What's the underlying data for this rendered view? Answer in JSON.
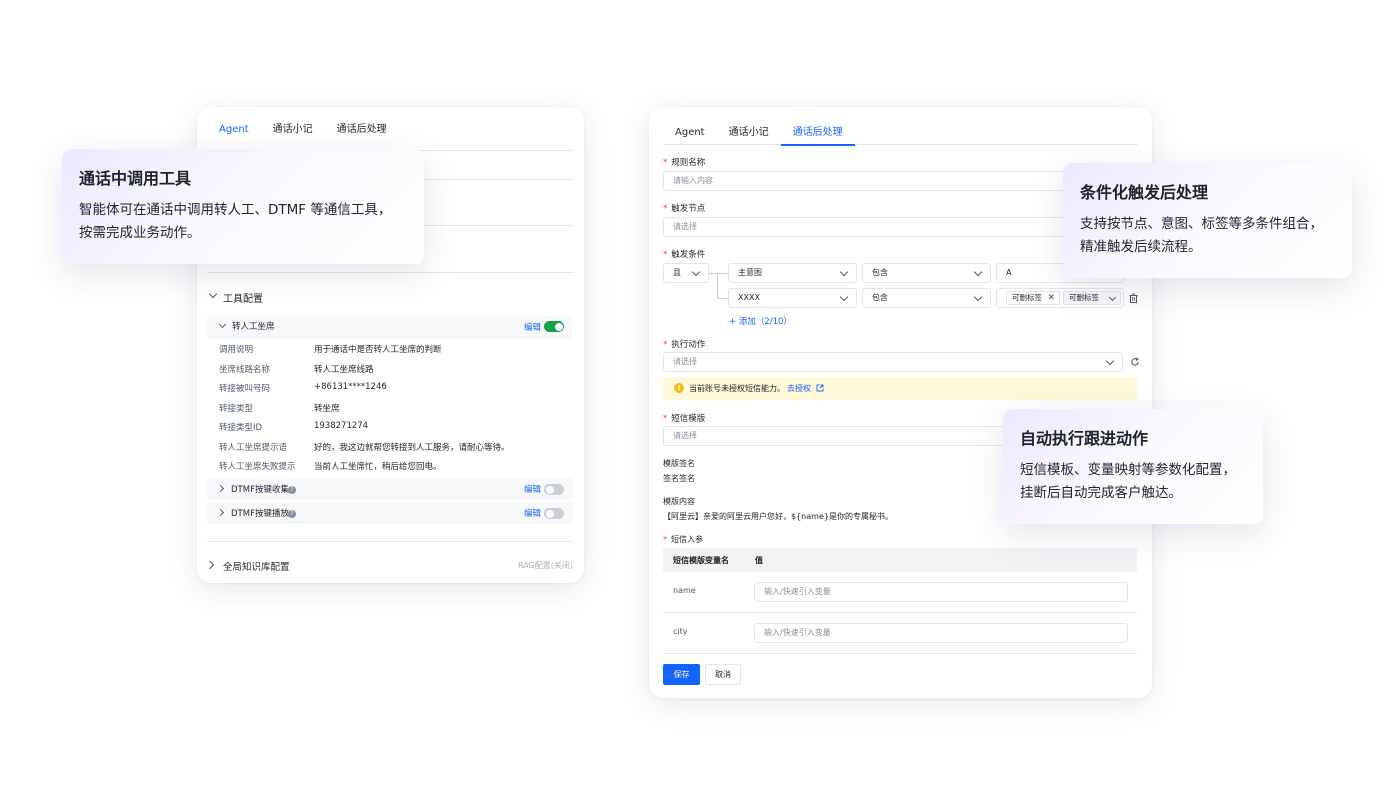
{
  "left_panel": {
    "tabs": [
      "Agent",
      "通话小记",
      "通话后处理"
    ],
    "tool_config_label": "工具配置",
    "transfer_title": "转人工坐席",
    "edit_label": "编辑",
    "transfer_rows": [
      {
        "k": "调用说明",
        "v": "用于通话中是否转人工坐席的判断"
      },
      {
        "k": "坐席线路名称",
        "v": "转人工坐席线路"
      },
      {
        "k": "转接被叫号码",
        "v": "+86131****1246"
      },
      {
        "k": "转接类型",
        "v": "转坐席"
      },
      {
        "k": "转接类型ID",
        "v": "1938271274"
      },
      {
        "k": "转人工坐席提示语",
        "v": "好的，我这边就帮您转接到人工服务，请耐心等待。"
      },
      {
        "k": "转人工坐席失败提示",
        "v": "当前人工坐席忙，稍后给您回电。"
      }
    ],
    "dtmf_collect": "DTMF按键收集",
    "dtmf_play": "DTMF按键播放",
    "help_glyph": "?",
    "knowledge_label": "全局知识库配置",
    "rag_label": "RAG配置(关闭)"
  },
  "right_panel": {
    "tabs": [
      "Agent",
      "通话小记",
      "通话后处理"
    ],
    "rule_name_label": "规则名称",
    "rule_name_placeholder": "请输入内容",
    "trigger_node_label": "触发节点",
    "trigger_node_placeholder": "请选择",
    "trigger_cond_label": "触发条件",
    "logic_op": "且",
    "cond1": {
      "field": "主意图",
      "op": "包含",
      "value": "A"
    },
    "cond2": {
      "field": "XXXX",
      "op": "包含",
      "tag1": "可删标签",
      "tag2": "可删标签"
    },
    "add_label": "+ 添加（2/10）",
    "action_label": "执行动作",
    "action_placeholder": "请选择",
    "warning_text": "当前账号未授权短信能力。",
    "warning_link": "去授权",
    "sms_template_label": "短信模版",
    "sms_template_placeholder": "请选择",
    "sign_label": "模版签名",
    "sign_value": "签名签名",
    "content_label": "模版内容",
    "content_value": "【阿里云】亲爱的阿里云用户您好，${name}是你的专属秘书。",
    "params_label": "短信入参",
    "params_table": {
      "headers": [
        "短信模版变量名",
        "值"
      ],
      "rows": [
        {
          "name": "name",
          "placeholder": "输入/快速引入变量"
        },
        {
          "name": "city",
          "placeholder": "输入/快速引入变量"
        }
      ]
    },
    "save_label": "保存",
    "cancel_label": "取消"
  },
  "cards": [
    {
      "title": "通话中调用工具",
      "line1": "智能体可在通话中调用转人工、DTMF 等通信工具，",
      "line2": "按需完成业务动作。"
    },
    {
      "title": "条件化触发后处理",
      "line1": "支持按节点、意图、标签等多条件组合，",
      "line2": "精准触发后续流程。"
    },
    {
      "title": "自动执行跟进动作",
      "line1": "短信模板、变量映射等参数化配置，",
      "line2": "挂断后自动完成客户触达。"
    }
  ],
  "colors": {
    "accent": "#1664ff",
    "toggle_on": "#14a047",
    "required": "#f53f3f",
    "warning_bg": "#fff8d9"
  }
}
